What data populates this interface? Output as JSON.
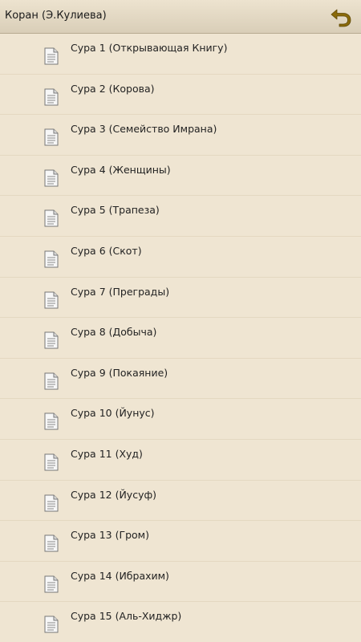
{
  "header": {
    "title": "Коран (Э.Кулиева)",
    "back_icon": "back-arrow-icon",
    "accent_color": "#8a6a0a"
  },
  "list": {
    "items": [
      {
        "label": "Сура 1 (Открывающая Книгу)",
        "icon": "document-icon"
      },
      {
        "label": "Сура 2 (Корова)",
        "icon": "document-icon"
      },
      {
        "label": "Сура 3 (Семейство Имрана)",
        "icon": "document-icon"
      },
      {
        "label": "Сура 4 (Женщины)",
        "icon": "document-icon"
      },
      {
        "label": "Сура 5 (Трапеза)",
        "icon": "document-icon"
      },
      {
        "label": "Сура 6 (Скот)",
        "icon": "document-icon"
      },
      {
        "label": "Сура 7 (Преграды)",
        "icon": "document-icon"
      },
      {
        "label": "Сура 8 (Добыча)",
        "icon": "document-icon"
      },
      {
        "label": "Сура 9 (Покаяние)",
        "icon": "document-icon"
      },
      {
        "label": "Сура 10 (Йунус)",
        "icon": "document-icon"
      },
      {
        "label": "Сура 11 (Худ)",
        "icon": "document-icon"
      },
      {
        "label": "Сура 12 (Йусуф)",
        "icon": "document-icon"
      },
      {
        "label": "Сура 13 (Гром)",
        "icon": "document-icon"
      },
      {
        "label": "Сура 14 (Ибрахим)",
        "icon": "document-icon"
      },
      {
        "label": "Сура 15 (Аль-Хиджр)",
        "icon": "document-icon"
      }
    ]
  }
}
